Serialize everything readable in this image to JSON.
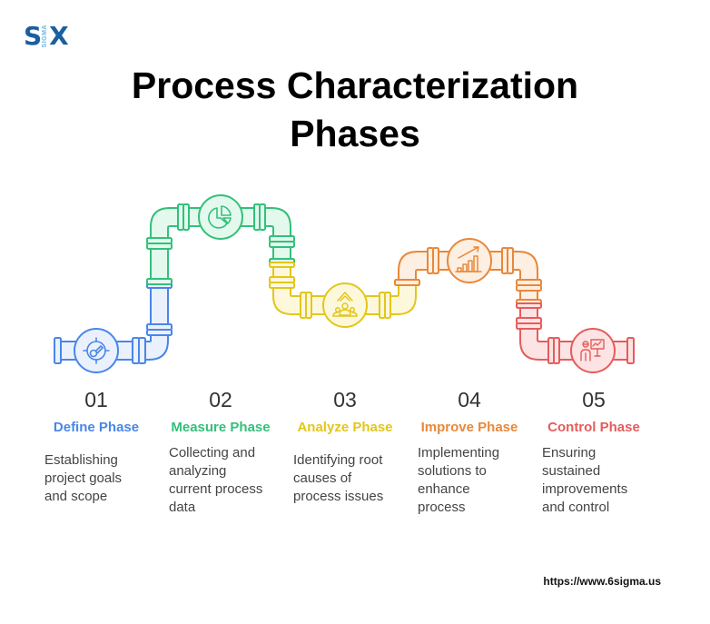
{
  "logo": {
    "left": "S",
    "middle": "SIGMA",
    "right": "X"
  },
  "title": {
    "line1": "Process Characterization",
    "line2": "Phases"
  },
  "colors": {
    "define": "#4a86e8",
    "measure": "#34c07a",
    "analyze": "#e3c61a",
    "improve": "#e8883a",
    "control": "#e65c5c"
  },
  "phases": [
    {
      "number": "01",
      "name": "Define Phase",
      "icon": "gauge-target-icon",
      "color": "#4a86e8",
      "fill": "#eaf1fd",
      "description_lines": [
        "Establishing",
        "project goals",
        "and scope"
      ]
    },
    {
      "number": "02",
      "name": "Measure Phase",
      "icon": "pie-chart-icon",
      "color": "#34c07a",
      "fill": "#e3f9ee",
      "description_lines": [
        "Collecting and",
        "analyzing",
        "current process",
        "data"
      ]
    },
    {
      "number": "03",
      "name": "Analyze Phase",
      "icon": "team-growth-icon",
      "color": "#e3c61a",
      "fill": "#fdf8dc",
      "description_lines": [
        "Identifying root",
        "causes of",
        "process issues"
      ]
    },
    {
      "number": "04",
      "name": "Improve Phase",
      "icon": "growth-bar-chart-icon",
      "color": "#e8883a",
      "fill": "#fdefe2",
      "description_lines": [
        "Implementing",
        "solutions to",
        "enhance",
        "process"
      ]
    },
    {
      "number": "05",
      "name": "Control Phase",
      "icon": "presenter-board-icon",
      "color": "#e65c5c",
      "fill": "#fde4e4",
      "description_lines": [
        "Ensuring",
        "sustained",
        "improvements",
        "and control"
      ]
    }
  ],
  "footer": {
    "url": "https://www.6sigma.us"
  }
}
